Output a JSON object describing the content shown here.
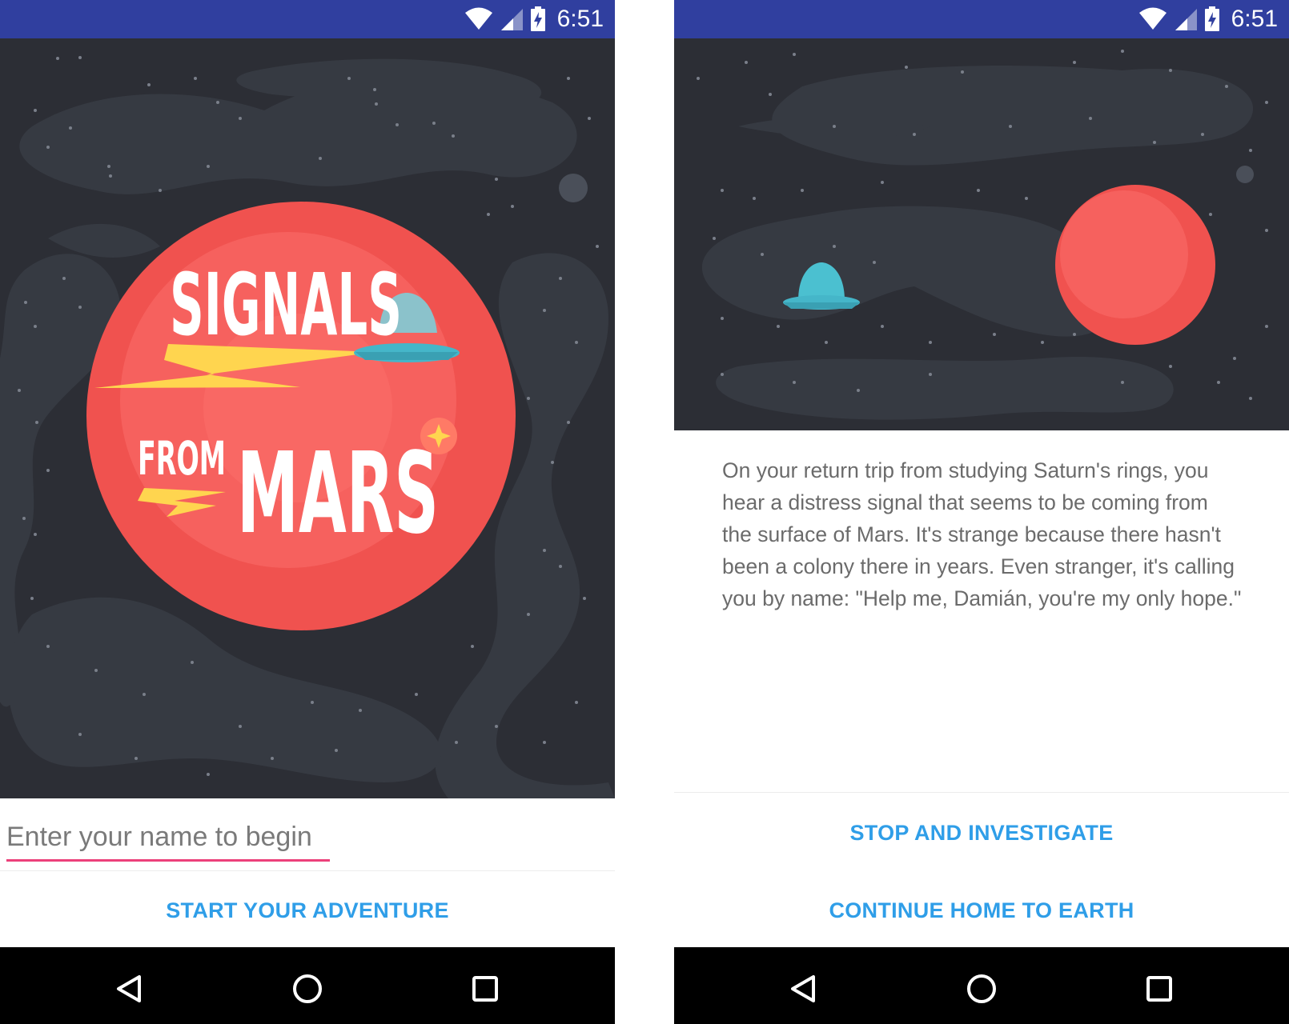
{
  "status_bar": {
    "time": "6:51",
    "icons": [
      "wifi-icon",
      "cell-signal-icon",
      "battery-charging-icon"
    ],
    "color": "#303f9f"
  },
  "screen_start": {
    "logo_text": [
      "SIGNALS",
      "FROM",
      "MARS"
    ],
    "name_input": {
      "placeholder": "Enter your name to begin",
      "value": ""
    },
    "start_button_label": "START YOUR ADVENTURE"
  },
  "screen_story": {
    "story_text": "On your return trip from studying Saturn's rings, you hear a distress signal that seems to be coming from the surface of Mars. It's strange because there hasn't been a colony there in years. Even stranger, it's calling you by name: \"Help me, Damián, you're my only hope.\"",
    "choice_1_label": "STOP AND INVESTIGATE",
    "choice_2_label": "CONTINUE HOME TO EARTH"
  },
  "nav_bar": {
    "icons": [
      "back-icon",
      "home-icon",
      "recents-icon"
    ]
  },
  "colors": {
    "accent_text": "#2f9ee8",
    "input_underline": "#ec407a",
    "space_background": "#2c2e35",
    "mars": "#f0524f",
    "ufo": "#4bc0d0"
  }
}
